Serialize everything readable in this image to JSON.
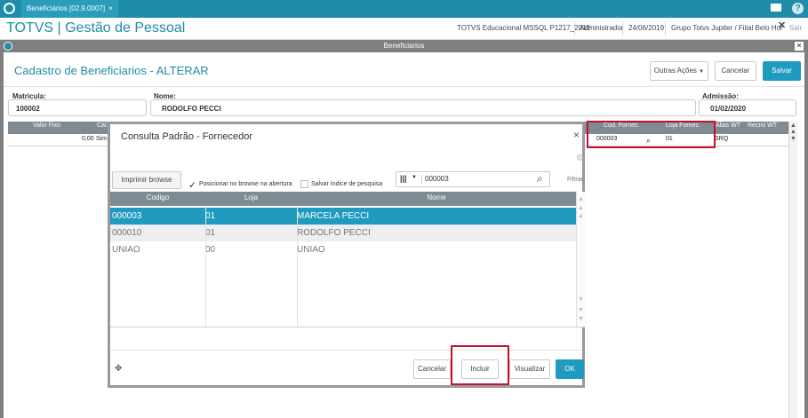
{
  "os_tab": {
    "label": "Beneficiários [02.9.0007]",
    "close": "×"
  },
  "header": {
    "app_title": "TOTVS | Gestão de Pessoal",
    "environment": "TOTVS Educacional MSSQL P1217_2019",
    "user": "Administrador",
    "date": "24/06/2019",
    "group": "Grupo Totvs Jupiter / Filial Belo Hor",
    "exit_label": "Sair"
  },
  "window": {
    "title": "Beneficiarios"
  },
  "page": {
    "title": "Cadastro de Beneficiarios - ALTERAR",
    "actions_label": "Outras Ações",
    "cancel_label": "Cancelar",
    "save_label": "Salvar"
  },
  "fields": {
    "matricula_label": "Matrícula:",
    "matricula_value": "100002",
    "nome_label": "Nome:",
    "nome_value": "RODOLFO PECCI",
    "admissao_label": "Admissão:",
    "admissao_value": "01/02/2020"
  },
  "grid": {
    "headers": [
      "Valor Fixo",
      "Cal.",
      "Cód. Fornec.",
      "Loja Fornec.",
      "Alias WT",
      "Recno WT"
    ],
    "row": {
      "valor_fixo": "0,00",
      "cal": "Sim",
      "cod_fornec": "000003",
      "loja_fornec": "01",
      "alias_wt": "SRQ"
    }
  },
  "modal": {
    "title": "Consulta Padrão - Fornecedor",
    "close": "×",
    "print_label": "Imprimir browse",
    "position_label": "Posicionar no browse na abertura",
    "position_checked": true,
    "save_index_label": "Salvar índice de pesquisa",
    "save_index_checked": false,
    "search_value": "000003",
    "filter_label": "Filtrar",
    "columns": [
      "Codigo",
      "Loja",
      "Nome"
    ],
    "rows": [
      {
        "codigo": "000003",
        "loja": "01",
        "nome": "MARCELA PECCI"
      },
      {
        "codigo": "000010",
        "loja": "01",
        "nome": "RODOLFO PECCI"
      },
      {
        "codigo": "UNIAO",
        "loja": "00",
        "nome": "UNIAO"
      }
    ],
    "selected_row": 0,
    "buttons": {
      "cancel": "Cancelar",
      "include": "Incluir",
      "view": "Visualizar",
      "ok": "OK"
    }
  },
  "colors": {
    "accent": "#1f9bbf",
    "highlight": "#c8102e",
    "header_gray": "#7f8a93"
  }
}
